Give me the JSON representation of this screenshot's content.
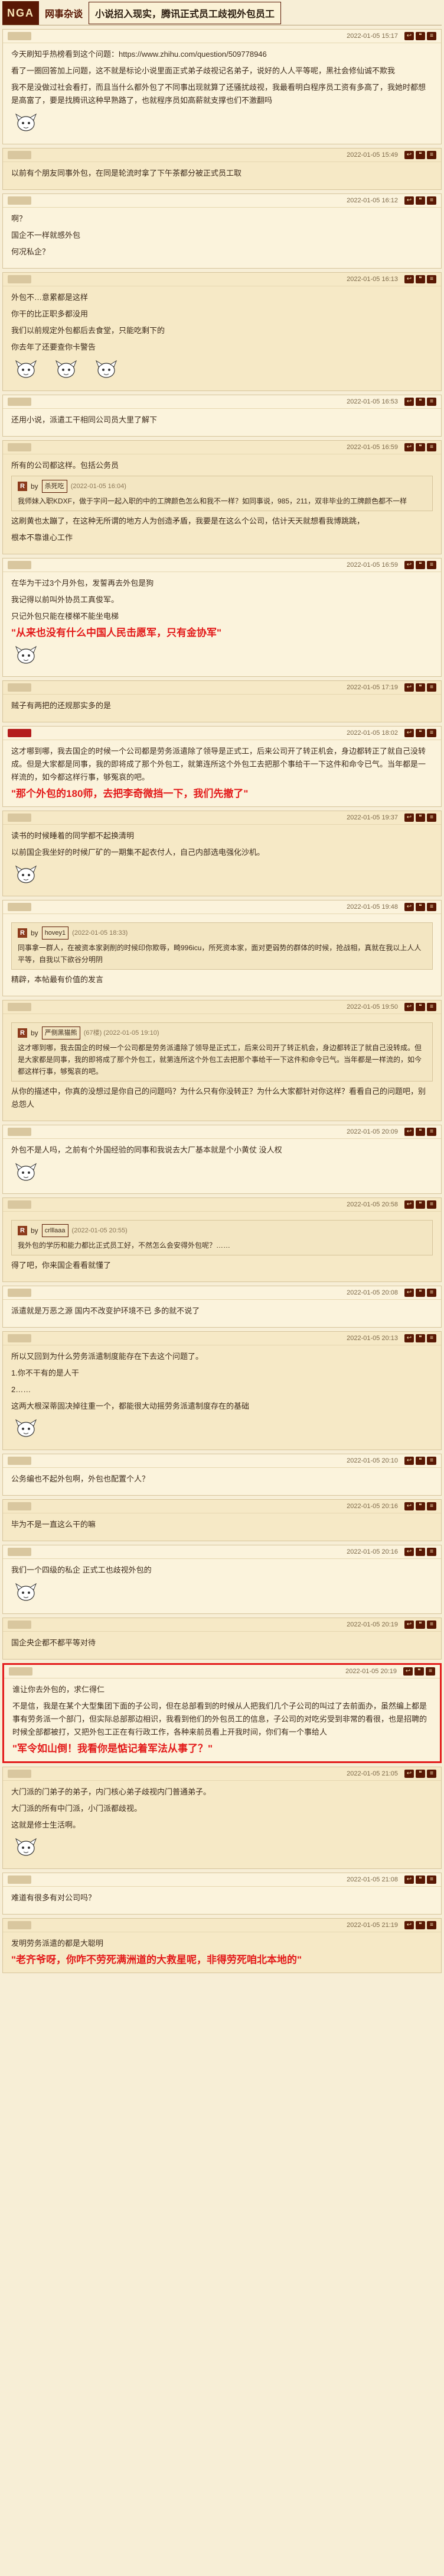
{
  "header": {
    "logo": "NGA",
    "section": "网事杂谈",
    "title": "小说招入现实，腾讯正式员工歧视外包员工"
  },
  "posts": [
    {
      "time": "2022-01-05 15:17",
      "paras": [
        "今天刷知乎热榜看到这个问题：https://www.zhihu.com/question/509778946",
        "看了一圈回答加上问题，这不就是标论小说里面正式弟子歧视记名弟子，说好的人人平等呢，黑社会修仙诚不欺我",
        "我不是没做过社会看打，而且当什么都外包了不同事出现就算了还骚扰歧视，我最看明白程序员工资有多高了，我她时都想是高富了，要是找腾讯这种早熟路了，也就程序员如高薪就支撑也们不激翻吗"
      ]
    },
    {
      "time": "2022-01-05 15:49",
      "paras": [
        "以前有个朋友同事外包，在同是轮流时拿了下午茶都分被正式员工取"
      ]
    },
    {
      "time": "2022-01-05 16:12",
      "paras": [
        "啊？",
        "国企不一样就感外包",
        "何况私企？"
      ]
    },
    {
      "time": "2022-01-05 16:13",
      "paras": [
        "外包不…意累都是这样",
        "你干的比正职多都没用",
        "我们以前规定外包都后去食堂，只能吃剩下的",
        "你去年了还要查你卡警告"
      ]
    },
    {
      "time": "2022-01-05 16:53",
      "paras": [
        "还用小说，派遣工干相同公司员大里了解下"
      ]
    },
    {
      "time": "2022-01-05 16:59",
      "paras": [
        "所有的公司都这样。包括公务员"
      ],
      "quote": {
        "user": "杀死吃",
        "time": "(2022-01-05 16:04)",
        "text": "我师妹入职KDXF，做于字问一起入职的中的工牌颜色怎么和我不一样？如同事说，985，211，双非毕业的工牌颜色都不一样"
      },
      "extra": [
        "这刷黄也太蹦了，在这种无所谓的地方人为创造矛盾，我要是在这么个公司，估计天天就想看我博跳跳，",
        "根本不靠谁心工作"
      ]
    },
    {
      "time": "2022-01-05 16:59",
      "paras": [
        "在华为干过3个月外包，发誓再去外包是狗",
        "我记得以前叫外协员工真俊军。",
        "只记外包只能在楼梯不能坐电梯"
      ],
      "annot": "\"从来也没有什么中国人民击愿军，只有金协军\""
    },
    {
      "time": "2022-01-05 17:19",
      "paras": [
        "贼子有两把的还规那实多的是"
      ]
    },
    {
      "time": "2022-01-05 18:02",
      "paras": [
        "这才哪到哪，我去国企的时候一个公司都是劳务派遣除了领导是正式工，后来公司开了转正机会，身边都转正了就自己没转成。但是大家都是同事，我的即将成了那个外包工，就第连所这个外包工去把那个事给干一下这件和命令已气。当年都是一样流的，如今都这样行事，够冤哀的吧。"
      ],
      "annot": "\"那个外包的180师，去把李奇微挡一下，我们先撤了\""
    },
    {
      "time": "2022-01-05 19:37",
      "paras": [
        "读书的时候睡着的同学都不起换清明",
        "以前国企我坐好的时候厂矿的一期集不起衣付人，自己内部选电强化沙机。"
      ]
    },
    {
      "time": "2022-01-05 19:48",
      "paras": [],
      "quote": {
        "user": "hovey1",
        "time": "(2022-01-05 18:33)",
        "text": "同事拿一群人，在被资本家剥削的时候印你欺辱，畸996icu，所死资本家，面对更弱势的群体的时候，抢战相，真就在我以上人人平等，自我以下欲谷分明阴"
      },
      "extra": [
        "精辟，本帖最有价值的发言"
      ]
    },
    {
      "time": "2022-01-05 19:50",
      "paras": [],
      "quote": {
        "user": "严侧黑猫熊",
        "time": "(67楼) (2022-01-05 19:10)",
        "text": "这才哪到哪，我去国企的时候一个公司都是劳务派遣除了领导是正式工，后来公司开了转正机会，身边都转正了就自己没转成。但是大家都是同事，我的即将成了那个外包工，就第连所这个外包工去把那个事给干一下这件和命令已气。当年都是一样流的，如今都这样行事，够冤哀的吧。"
      },
      "extra": [
        "从你的描述中，你真的没想过是你自己的问题吗？为什么只有你没转正？为什么大家都针对你这样？看看自己的问题吧，别总怨人"
      ]
    },
    {
      "time": "2022-01-05 20:09",
      "paras": [
        "外包不是人吗，之前有个外国经验的同事和我说去大厂基本就是个小黄仗 没人权"
      ]
    },
    {
      "time": "2022-01-05 20:58",
      "paras": [],
      "quote": {
        "user": "crlllaaa",
        "time": "(2022-01-05 20:55)",
        "text": "我外包的学历和能力都比正式员工好，不然怎么会安得外包呢？……"
      },
      "extra": [
        "得了吧，你来国企看看就懂了"
      ]
    },
    {
      "time": "2022-01-05 20:08",
      "paras": [
        "派遣就是万恶之源 国内不改变护环境不已 多的就不说了"
      ]
    },
    {
      "time": "2022-01-05 20:13",
      "paras": [
        "所以又回到为什么劳务派遣制度能存在下去这个问题了。",
        "1.你不干有的是人干",
        "2……",
        "这两大根深蒂固决掉往重一个，都能很大动摇劳务派遣制度存在的基础"
      ]
    },
    {
      "time": "2022-01-05 20:10",
      "paras": [
        "公务编也不起外包啊，外包也配置个人？"
      ]
    },
    {
      "time": "2022-01-05 20:16",
      "paras": [
        "毕为不是一直这么干的嘛"
      ]
    },
    {
      "time": "2022-01-05 20:16",
      "paras": [
        "我们一个四级的私企 正式工也歧视外包的"
      ]
    },
    {
      "time": "2022-01-05 20:19",
      "paras": [
        "国企央企都不都平等对待"
      ]
    },
    {
      "time": "2022-01-05 20:19",
      "paras": [
        "谁让你去外包的，求仁得仁",
        "不是信，我是在某个大型集团下面的子公司，但在总部看到的时候从人把我们几个子公司的叫过了去前面办，虽然编上都是事有劳务派一个部门，但实际总部那边相识，我看到他们的外包员工的信息，子公司的对吃劣受到非常的看很，也是招聘的时候全部都被打，又把外包工正在有行政工作，各种来前员看上开我时间，你们有一个事给人"
      ],
      "annot": "\"军令如山倒！我看你是惦记着军法从事了？\"",
      "boxed": true
    },
    {
      "time": "2022-01-05 21:05",
      "paras": [
        "大门派的门弟子的弟子，内门核心弟子歧视内门普通弟子。",
        "大门派的所有中门派，小门派都歧视。",
        "这就是修士生活啊。"
      ]
    },
    {
      "time": "2022-01-05 21:08",
      "paras": [
        "难道有很多有对公司吗？"
      ]
    },
    {
      "time": "2022-01-05 21:19",
      "paras": [
        "发明劳务派遣的都是大聪明"
      ],
      "annot": "\"老齐爷呀，你咋不劳死满洲道的大救星呢，非得劳死咱北本地的\""
    }
  ]
}
